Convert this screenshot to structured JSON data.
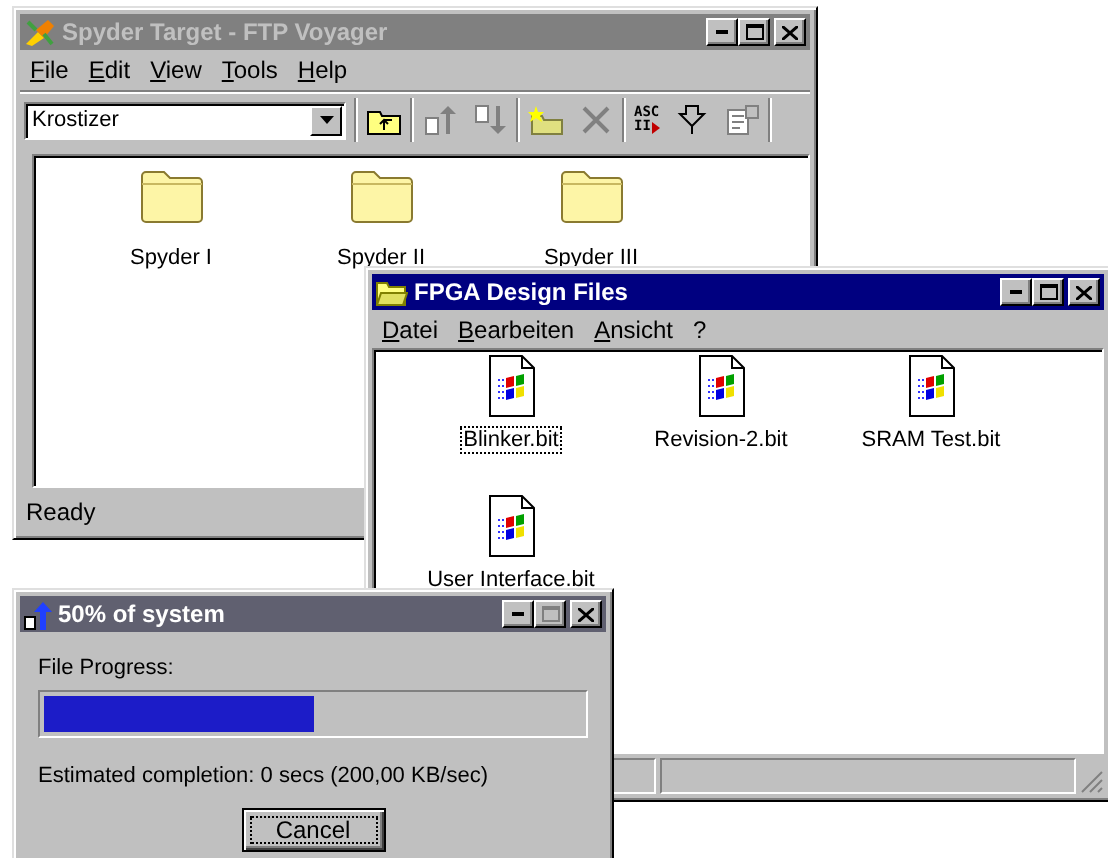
{
  "ftp_window": {
    "title": "Spyder Target - FTP Voyager",
    "active": false,
    "menu": [
      "File",
      "Edit",
      "View",
      "Tools",
      "Help"
    ],
    "address": "Krostizer",
    "toolbar": [
      {
        "buttons": [
          {
            "kind": "folder-up",
            "disabled": false
          }
        ]
      },
      {
        "buttons": [
          {
            "kind": "upload",
            "disabled": true
          },
          {
            "kind": "download",
            "disabled": true
          }
        ]
      },
      {
        "buttons": [
          {
            "kind": "new-folder",
            "disabled": false
          },
          {
            "kind": "delete",
            "disabled": true
          }
        ]
      },
      {
        "buttons": [
          {
            "kind": "ascii",
            "disabled": false,
            "lines": [
              "ASC",
              "II"
            ]
          },
          {
            "kind": "filter",
            "disabled": false
          },
          {
            "kind": "properties",
            "disabled": true
          }
        ]
      }
    ],
    "items": [
      {
        "label": "Spyder I",
        "selected": false
      },
      {
        "label": "Spyder II",
        "selected": false
      },
      {
        "label": "Spyder III",
        "selected": false
      }
    ],
    "status": "Ready"
  },
  "fpga_window": {
    "title": "FPGA Design Files",
    "active": true,
    "menu": [
      "Datei",
      "Bearbeiten",
      "Ansicht",
      "?"
    ],
    "items": [
      {
        "label": "Blinker.bit",
        "selected": true
      },
      {
        "label": "Revision-2.bit",
        "selected": false
      },
      {
        "label": "SRAM Test.bit",
        "selected": false
      },
      {
        "label": "User Interface.bit",
        "selected": false
      }
    ]
  },
  "progress_dialog": {
    "title": "50% of system",
    "active": false,
    "label": "File Progress:",
    "level": 0.5,
    "estimate": "Estimated completion: 0 secs (200,00 KB/sec)",
    "button": "Cancel"
  }
}
